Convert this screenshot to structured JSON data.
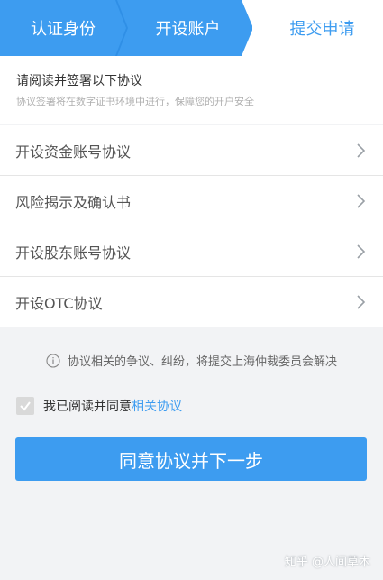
{
  "steps": [
    {
      "label": "认证身份"
    },
    {
      "label": "开设账户"
    },
    {
      "label": "提交申请"
    }
  ],
  "intro": {
    "title": "请阅读并签署以下协议",
    "subtitle": "协议签署将在数字证书环境中进行，保障您的开户安全"
  },
  "agreements": [
    {
      "label": "开设资金账号协议"
    },
    {
      "label": "风险揭示及确认书"
    },
    {
      "label": "开设股东账号协议"
    },
    {
      "label": "开设OTC协议"
    }
  ],
  "notice": {
    "text": "协议相关的争议、纠纷，将提交上海仲裁委员会解决"
  },
  "consent": {
    "text": "我已阅读并同意",
    "link": "相关协议"
  },
  "submit": {
    "label": "同意协议并下一步"
  },
  "watermark": "知乎 @人间草木",
  "colors": {
    "accent": "#3d9cf0",
    "background": "#f2f3f5"
  }
}
